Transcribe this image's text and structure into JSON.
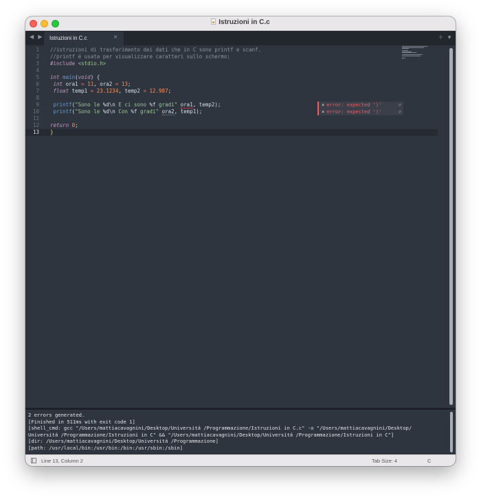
{
  "window": {
    "title": "Istruzioni in C.c"
  },
  "tabbar": {
    "nav_arrows": "◀ ▶",
    "tab_label": "Istruzioni in C.c",
    "tab_close": "×",
    "new_tab": "+",
    "menu": "▼"
  },
  "editor": {
    "line_numbers": [
      "1",
      "2",
      "3",
      "4",
      "5",
      "6",
      "7",
      "8",
      "9",
      "10",
      "11",
      "12",
      "13"
    ],
    "current_line": 13,
    "lines": [
      [
        {
          "t": "//istruzioni di trasferimento dei dati che in C sono printf e scanf.",
          "c": "cm"
        }
      ],
      [
        {
          "t": "//printf é usata per visualizzare caratteri sullo schermo;",
          "c": "cm"
        }
      ],
      [
        {
          "t": "#include ",
          "c": "pp"
        },
        {
          "t": "<stdio.h>",
          "c": "inc"
        }
      ],
      [],
      [
        {
          "t": "int",
          "c": "kw"
        },
        {
          "t": " "
        },
        {
          "t": "main",
          "c": "fn"
        },
        {
          "t": "("
        },
        {
          "t": "void",
          "c": "kw"
        },
        {
          "t": ") {"
        }
      ],
      [
        {
          "t": " "
        },
        {
          "t": "int",
          "c": "kw"
        },
        {
          "t": " ora1 "
        },
        {
          "t": "=",
          "c": "op"
        },
        {
          "t": " "
        },
        {
          "t": "11",
          "c": "num"
        },
        {
          "t": ", ora2 "
        },
        {
          "t": "=",
          "c": "op"
        },
        {
          "t": " "
        },
        {
          "t": "13",
          "c": "num"
        },
        {
          "t": ";"
        }
      ],
      [
        {
          "t": " "
        },
        {
          "t": "float",
          "c": "kw"
        },
        {
          "t": " temp1 "
        },
        {
          "t": "=",
          "c": "op"
        },
        {
          "t": " "
        },
        {
          "t": "23.1234",
          "c": "num"
        },
        {
          "t": ", temp2 "
        },
        {
          "t": "=",
          "c": "op"
        },
        {
          "t": " "
        },
        {
          "t": "12.987",
          "c": "num"
        },
        {
          "t": ";"
        }
      ],
      [],
      [
        {
          "t": " "
        },
        {
          "t": "printf",
          "c": "fn"
        },
        {
          "t": "("
        },
        {
          "t": "\"Sono le ",
          "c": "str"
        },
        {
          "t": "%d\\n",
          "c": "esc"
        },
        {
          "t": " E ci sono ",
          "c": "str"
        },
        {
          "t": "%f",
          "c": "esc"
        },
        {
          "t": " gradi\"",
          "c": "str"
        },
        {
          "t": " "
        },
        {
          "t": "ora1",
          "c": "err-u"
        },
        {
          "t": ", temp2);"
        }
      ],
      [
        {
          "t": " "
        },
        {
          "t": "printf",
          "c": "fn"
        },
        {
          "t": "("
        },
        {
          "t": "\"Sono le ",
          "c": "str"
        },
        {
          "t": "%d\\n",
          "c": "esc"
        },
        {
          "t": " Con ",
          "c": "str"
        },
        {
          "t": "%f",
          "c": "esc"
        },
        {
          "t": " gradi\"",
          "c": "str"
        },
        {
          "t": " "
        },
        {
          "t": "ora2",
          "c": "err-u"
        },
        {
          "t": ", temp1);"
        }
      ],
      [],
      [
        {
          "t": "return",
          "c": "kw"
        },
        {
          "t": " "
        },
        {
          "t": "0",
          "c": "num"
        },
        {
          "t": ";"
        }
      ],
      [
        {
          "t": "}",
          "c": "caret-hl"
        }
      ]
    ],
    "errors": [
      {
        "line": 9,
        "icon": "×",
        "message": "error: expected ')'",
        "dismiss": "⌀"
      },
      {
        "line": 10,
        "icon": "×",
        "message": "error: expected ')'",
        "dismiss": "⌀"
      }
    ]
  },
  "output": {
    "lines": [
      "2 errors generated.",
      "[Finished in 511ms with exit code 1]",
      "[shell_cmd: gcc \"/Users/mattiacavagnini/Desktop/Universitá /Programmazione/Istruzioni in C.c\" -o \"/Users/mattiacavagnini/Desktop/",
      "Universitá /Programmazione/Istruzioni in C\" && \"/Users/mattiacavagnini/Desktop/Universitá /Programmazione/Istruzioni in C\"]",
      "[dir: /Users/mattiacavagnini/Desktop/Universitá /Programmazione]",
      "[path: /usr/local/bin:/usr/bin:/bin:/usr/sbin:/sbin]"
    ]
  },
  "status": {
    "position": "Line 13, Column 2",
    "tab_size": "Tab Size: 4",
    "syntax": "C"
  }
}
